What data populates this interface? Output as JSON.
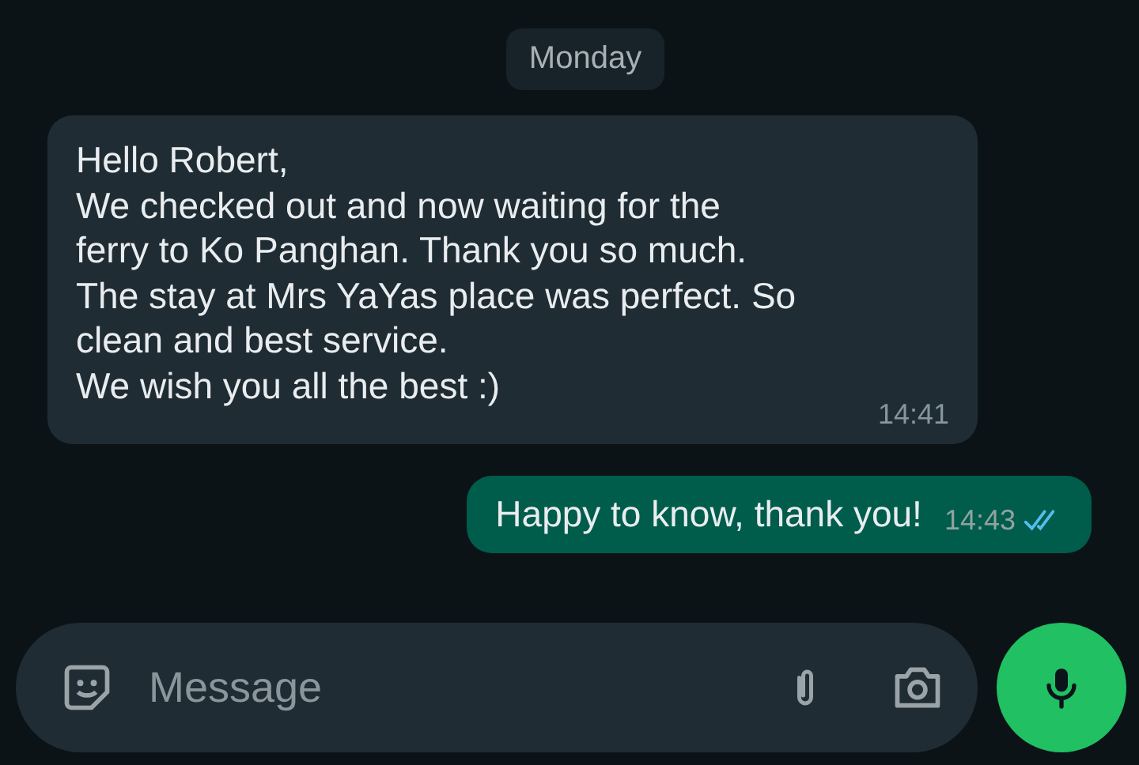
{
  "date_chip": "Monday",
  "messages": [
    {
      "kind": "incoming",
      "text": "Hello Robert,\nWe checked out and now waiting for the\nferry to Ko Panghan. Thank you so much.\nThe stay at Mrs YaYas place was perfect. So\nclean and best service.\nWe wish you all the best :)",
      "time": "14:41"
    },
    {
      "kind": "outgoing",
      "text": "Happy to know, thank you!",
      "time": "14:43",
      "read": true
    }
  ],
  "composer": {
    "placeholder": "Message"
  }
}
